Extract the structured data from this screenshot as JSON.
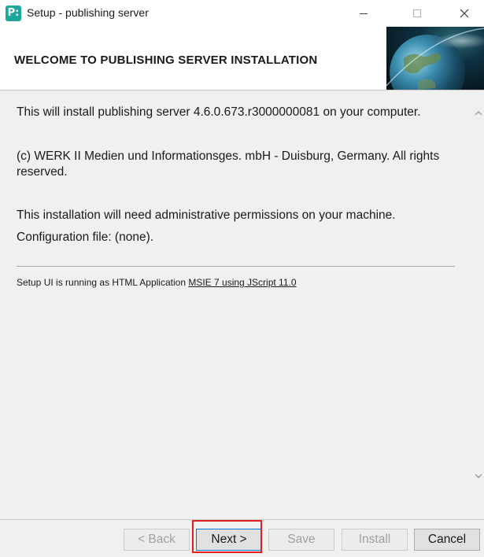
{
  "window": {
    "app_icon_glyph": "P:",
    "title": "Setup - publishing server"
  },
  "header": {
    "title": "WELCOME TO PUBLISHING SERVER INSTALLATION"
  },
  "content": {
    "line1": "This will install publishing server 4.6.0.673.r3000000081 on your computer.",
    "line2": "(c) WERK II Medien und Informationsges. mbH - Duisburg, Germany. All rights reserved.",
    "line3": "This installation will need administrative permissions on your machine.",
    "line4": "Configuration file: (none).",
    "ui_info_prefix": "Setup UI is running as HTML Application ",
    "ui_info_link": "MSIE 7 using JScript 11.0"
  },
  "footer": {
    "back_label": "< Back",
    "next_label": "Next >",
    "save_label": "Save",
    "install_label": "Install",
    "cancel_label": "Cancel"
  },
  "colors": {
    "app_icon": "#1aa89a",
    "highlight": "#e0201e",
    "focus_border": "#0078d7"
  }
}
